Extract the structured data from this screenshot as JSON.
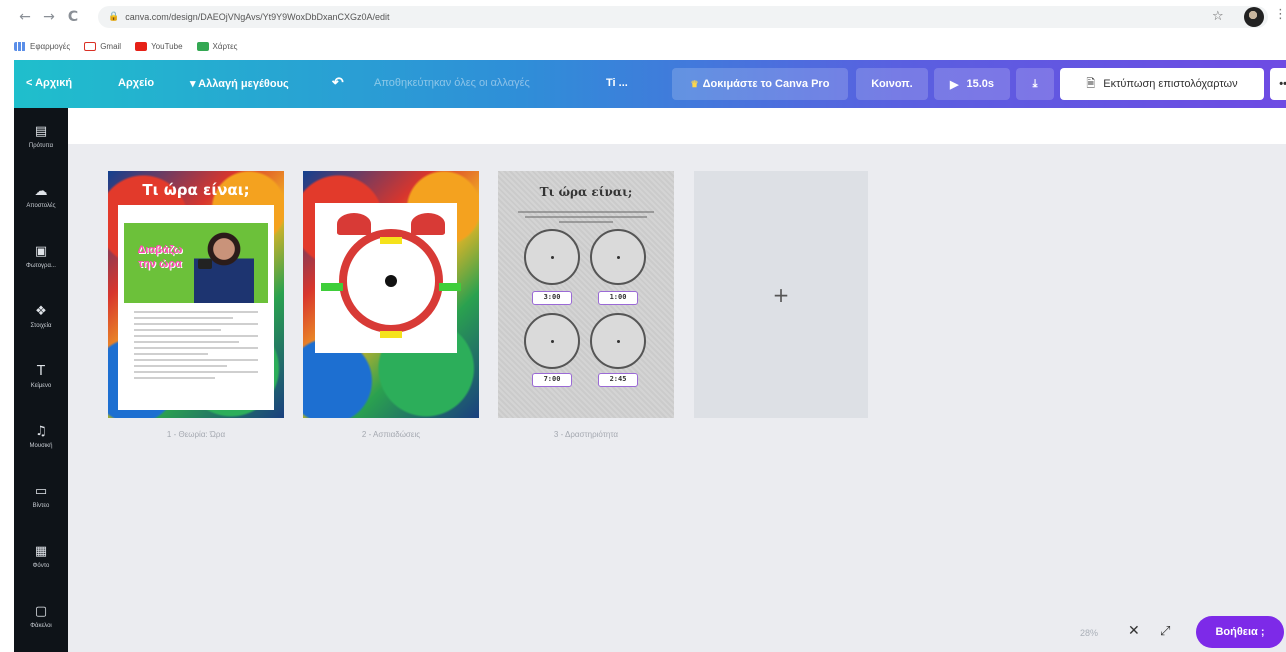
{
  "browser": {
    "nav": {
      "back": "←",
      "forward": "→",
      "reload": "C"
    },
    "url": "canva.com/design/DAEOjVNgAvs/Yt9Y9WoxDbDxanCXGz0A/edit",
    "bookmarks": [
      {
        "label": "Εφαρμογές",
        "icon": "apps-icon"
      },
      {
        "label": "Gmail",
        "icon": "gmail-icon"
      },
      {
        "label": "YouTube",
        "icon": "youtube-icon"
      },
      {
        "label": "Χάρτες",
        "icon": "maps-icon"
      }
    ]
  },
  "toolbar": {
    "home": "< Αρχική",
    "file": "Αρχείο",
    "resize": "▾ Αλλαγή μεγέθους",
    "saved_status": "Αποθηκεύτηκαν όλες οι αλλαγές",
    "title": "Ti ...",
    "try_pro": "Δοκιμάστε το Canva Pro",
    "share": "Κοινοπ.",
    "play_duration": "15.0s",
    "print_label": "Εκτύπωση επιστολόχαρτων",
    "more": "•••"
  },
  "sidebar": {
    "items": [
      {
        "label": "Πρότυπα",
        "icon": "templates-icon",
        "glyph": "▤"
      },
      {
        "label": "Αποστολές",
        "icon": "upload-icon",
        "glyph": "☁"
      },
      {
        "label": "Φωτογρα...",
        "icon": "photos-icon",
        "glyph": "▣"
      },
      {
        "label": "Στοιχεία",
        "icon": "elements-icon",
        "glyph": "❖"
      },
      {
        "label": "Κείμενο",
        "icon": "text-icon",
        "glyph": "T"
      },
      {
        "label": "Μουσική",
        "icon": "music-icon",
        "glyph": "♫"
      },
      {
        "label": "Βίντεο",
        "icon": "video-icon",
        "glyph": "▭"
      },
      {
        "label": "Φόντο",
        "icon": "background-icon",
        "glyph": "▦"
      },
      {
        "label": "Φάκελοι",
        "icon": "folder-icon",
        "glyph": "▢"
      }
    ]
  },
  "pages": [
    {
      "label": "1 - Θεωρία: Ώρα",
      "title": "Τι ώρα είναι;",
      "video_title": "Διαβάζω την ώρα"
    },
    {
      "label": "2 - Ασπιαδώσεις"
    },
    {
      "label": "3 - Δραστηριότητα",
      "title": "Τι ώρα είναι;",
      "times": [
        "3:00",
        "1:00",
        "7:00",
        "2:45"
      ]
    }
  ],
  "add_page": "+",
  "footer": {
    "zoom": "28%",
    "close_glyph": "✕",
    "expand_glyph": "⤢",
    "help": "Βοήθεια ;"
  }
}
